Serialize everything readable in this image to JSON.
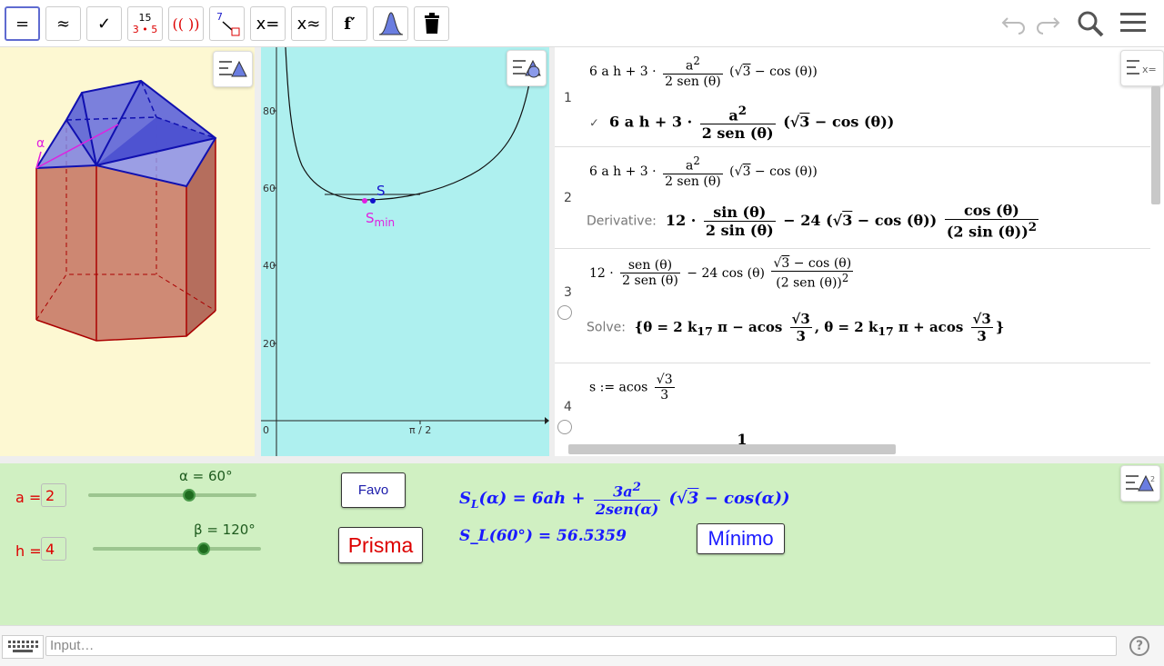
{
  "toolbar": {
    "buttons": [
      {
        "name": "evaluate",
        "label": "="
      },
      {
        "name": "numeric",
        "label": "≈"
      },
      {
        "name": "check",
        "label": "✓"
      },
      {
        "name": "factor-top",
        "label": "15"
      },
      {
        "name": "factor-bottom",
        "label": "3 • 5"
      },
      {
        "name": "expand",
        "label": "(( ))"
      },
      {
        "name": "substitute",
        "label": "7"
      },
      {
        "name": "solve",
        "label": "x="
      },
      {
        "name": "solve-numeric",
        "label": "x≈"
      },
      {
        "name": "derivative",
        "label": "f′"
      },
      {
        "name": "probability",
        "label": ""
      },
      {
        "name": "delete",
        "label": ""
      }
    ]
  },
  "graph": {
    "y_ticks": [
      "80",
      "60",
      "40",
      "20"
    ],
    "x_ticks": [
      "0",
      "π / 2"
    ],
    "point_s": "S",
    "point_smin": "S",
    "point_smin_sub": "min"
  },
  "panel3d": {
    "angle_label": "α"
  },
  "algebra": {
    "rows": [
      {
        "num": "1"
      },
      {
        "num": "2",
        "derivative_label": "Derivative:"
      },
      {
        "num": "3",
        "solve_label": "Solve:"
      },
      {
        "num": "4"
      }
    ]
  },
  "lower": {
    "a_label": "a =",
    "a_value": "2",
    "h_label": "h =",
    "h_value": "4",
    "alpha_caption": "α = 60°",
    "beta_caption": "β = 120°",
    "alpha_fraction": 0.6,
    "beta_fraction": 0.66,
    "favo_label": "Favo",
    "prisma_label": "Prisma",
    "minimo_label": "Mínimo",
    "value_line": "S_L(60°) = 56.5359"
  },
  "input": {
    "placeholder": "Input…",
    "help": "?"
  },
  "colors": {
    "graph_bg": "#aef0ef",
    "panel3d_bg": "#fdf8d2",
    "lower_bg": "#d0f0c2",
    "formula_blue": "#1a1aff",
    "accent_red": "#dd0000"
  }
}
